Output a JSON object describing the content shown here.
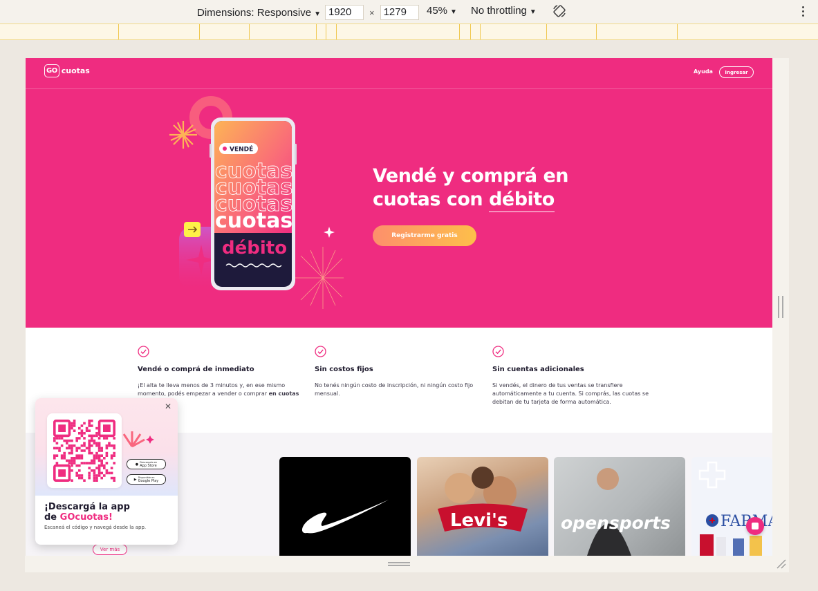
{
  "devtools": {
    "dimensions_label": "Dimensions: Responsive",
    "width": "1920",
    "height": "1279",
    "zoom": "45%",
    "throttling": "No throttling"
  },
  "site": {
    "logo_box": "GO",
    "logo_text": "cuotas",
    "nav_help": "Ayuda",
    "nav_login": "Ingresar",
    "hero": {
      "title_line1": "Vendé y comprá en",
      "title_line2_prefix": "cuotas con ",
      "title_line2_underlined": "débito",
      "cta": "Registrarme gratis",
      "phone_badge": "VENDÉ",
      "phone_word": "cuotas",
      "phone_word2": "débito"
    },
    "features": [
      {
        "title": "Vendé o comprá de inmediato",
        "text_before": "¡El alta te lleva menos de 3 minutos y, en ese mismo momento, podés empezar a vender o comprar ",
        "text_bold": "en cuotas"
      },
      {
        "title": "Sin costos fijos",
        "text": "No tenés ningún costo de inscripción, ni ningún costo fijo mensual."
      },
      {
        "title": "Sin cuentas adicionales",
        "text": "Si vendés, el dinero de tus ventas se transfiere automáticamente a tu cuenta. Si comprás, las cuotas se debitan de tu tarjeta de forma automática."
      }
    ],
    "brands": [
      "Nike",
      "Levi's",
      "opensports",
      "FARMA"
    ],
    "ver_mas": "Ver más"
  },
  "popup": {
    "title_line1": "¡Descargá la app",
    "title_line2_prefix": "de ",
    "title_line2_brand": "GOcuotas!",
    "subtitle": "Escaneá el código y navegá desde la app.",
    "app_store": "App Store",
    "app_store_small": "Descargalo en",
    "google_play": "Google Play",
    "google_play_small": "Disponible en"
  },
  "colors": {
    "brand_pink": "#ef2c80",
    "cta_gradient_start": "#fd8f6c",
    "cta_gradient_end": "#fdbf4a"
  }
}
